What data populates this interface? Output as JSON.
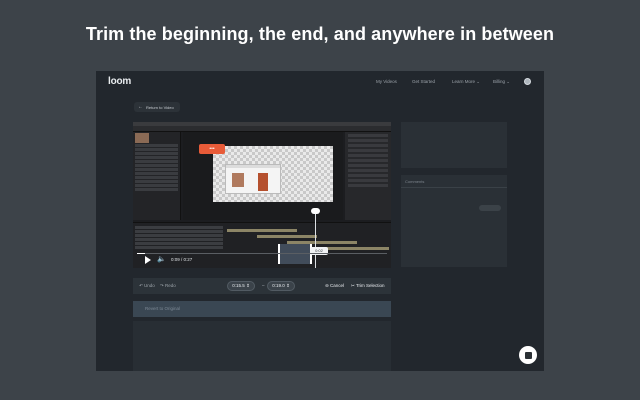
{
  "hero": {
    "headline": "Trim the beginning, the end, and anywhere in between"
  },
  "navbar": {
    "logo": "loom",
    "links": [
      "My Videos",
      "Get Started",
      "Learn More",
      "Billing"
    ]
  },
  "back_button": {
    "label": "Return to Video"
  },
  "player": {
    "time_display": "0:09 / 0:27",
    "selection_tooltip": "0:02",
    "bubble_text": "•••"
  },
  "trim_controls": {
    "undo_label": "Undo",
    "redo_label": "Redo",
    "start_time": "0:15.5",
    "separator": "–",
    "end_time": "0:19.0",
    "cancel_label": "Cancel",
    "trim_label": "Trim Selection"
  },
  "revert": {
    "label": "Revert to Original"
  },
  "side": {
    "card_label": "Comments"
  },
  "colors": {
    "background": "#3d4349",
    "app_bg": "#22272d",
    "accent": "#e85b38"
  }
}
